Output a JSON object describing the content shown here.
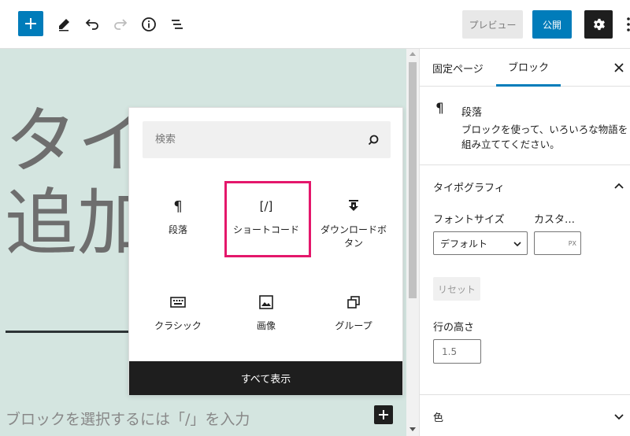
{
  "toolbar": {
    "add_icon": "plus-icon",
    "tools_icon": "pencil-icon",
    "undo_icon": "undo-icon",
    "redo_icon": "redo-icon",
    "info_icon": "info-icon",
    "outline_icon": "list-view-icon",
    "preview_label": "プレビュー",
    "publish_label": "公開",
    "settings_icon": "gear-icon",
    "accent": "#007cba"
  },
  "canvas": {
    "title_text": "タイ\n追加",
    "placeholder": "ブロックを選択するには「/」を入力",
    "background": "#d4e5e0"
  },
  "inserter": {
    "search_placeholder": "検索",
    "blocks": [
      {
        "label": "段落",
        "icon": "paragraph-icon"
      },
      {
        "label": "ショートコード",
        "icon": "shortcode-icon",
        "highlighted": true
      },
      {
        "label": "ダウンロードボタン",
        "icon": "download-icon"
      },
      {
        "label": "クラシック",
        "icon": "keyboard-icon"
      },
      {
        "label": "画像",
        "icon": "image-icon"
      },
      {
        "label": "グループ",
        "icon": "group-icon"
      }
    ],
    "show_all_label": "すべて表示",
    "highlight_color": "#e4176b"
  },
  "sidebar": {
    "tabs": [
      {
        "label": "固定ページ",
        "active": false
      },
      {
        "label": "ブロック",
        "active": true
      }
    ],
    "block_card": {
      "title": "段落",
      "description": "ブロックを使って、いろいろな物語を組み立ててください。"
    },
    "typography": {
      "title": "タイポグラフィ",
      "font_size_label": "フォントサイズ",
      "custom_label": "カスタ…",
      "font_size_value": "デフォルト",
      "unit": "PX",
      "reset_label": "リセット",
      "line_height_label": "行の高さ",
      "line_height_placeholder": "1.5"
    },
    "color": {
      "title": "色"
    }
  }
}
